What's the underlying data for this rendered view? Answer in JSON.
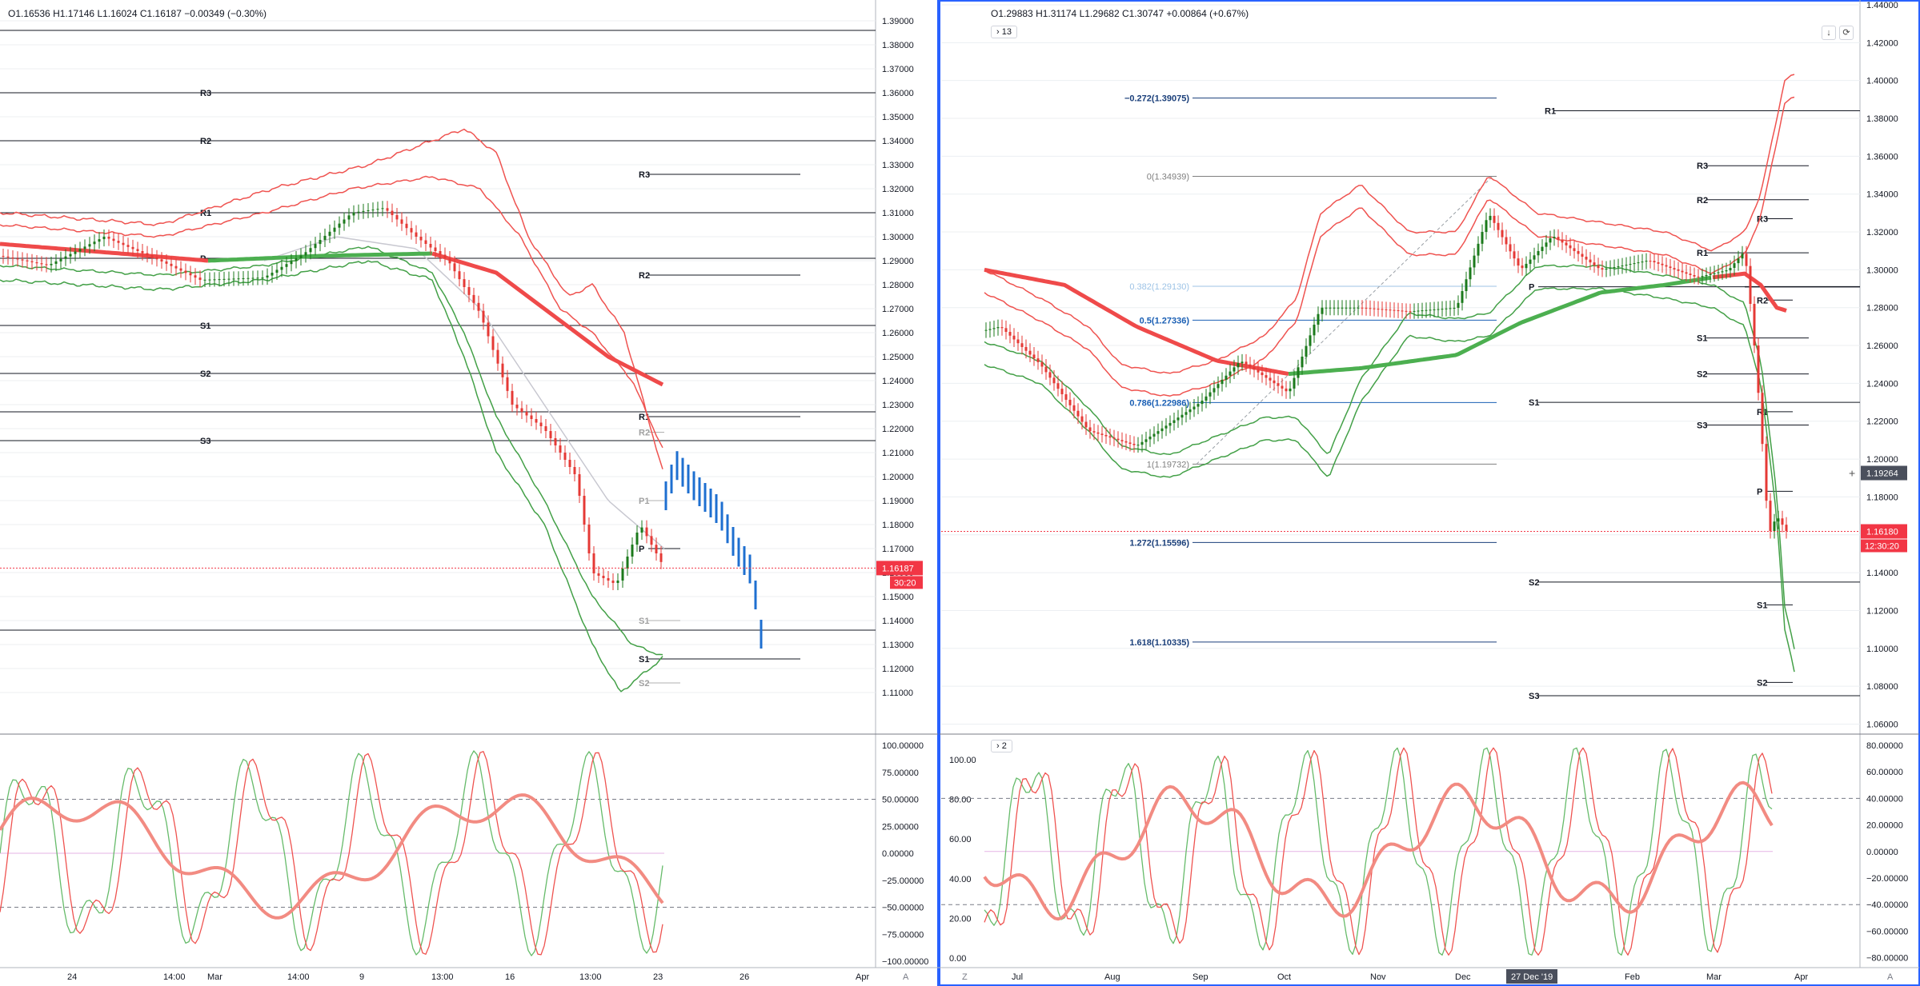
{
  "left": {
    "ohlc": {
      "o": "O1.16536",
      "h": "H1.17146",
      "l": "L1.16024",
      "c": "C1.16187",
      "chg": "−0.00349 (−0.30%)"
    },
    "price_badge": {
      "price": "1.16187",
      "timer": "30:20"
    },
    "yticks": [
      "1.39000",
      "1.38000",
      "1.37000",
      "1.36000",
      "1.35000",
      "1.34000",
      "1.33000",
      "1.32000",
      "1.31000",
      "1.30000",
      "1.29000",
      "1.28000",
      "1.27000",
      "1.26000",
      "1.25000",
      "1.24000",
      "1.23000",
      "1.22000",
      "1.21000",
      "1.20000",
      "1.19000",
      "1.18000",
      "1.17000",
      "1.16000",
      "1.15000",
      "1.14000",
      "1.13000",
      "1.12000",
      "1.11000"
    ],
    "osc_ticks": [
      "100.00000",
      "75.00000",
      "50.00000",
      "25.00000",
      "0.00000",
      "−25.00000",
      "−50.00000",
      "−75.00000",
      "−100.00000"
    ],
    "xticks": [
      "24",
      "14:00",
      "Mar",
      "14:00",
      "9",
      "13:00",
      "16",
      "13:00",
      "23",
      "26",
      "Apr"
    ],
    "pivots": [
      "R3",
      "R2",
      "R1",
      "P",
      "S1",
      "S2",
      "S3",
      "R3",
      "R2",
      "R1",
      "R2",
      "P1",
      "P",
      "S1",
      "S1",
      "S2"
    ],
    "corner": "A"
  },
  "right": {
    "ohlc": {
      "o": "O1.29883",
      "h": "H1.31174",
      "l": "L1.29682",
      "c": "C1.30747",
      "chg": "+0.00864 (+0.67%)"
    },
    "collapse_main": "13",
    "collapse_osc": "2",
    "crosshair_price": "1.19264",
    "price_badge": {
      "price": "1.16180",
      "timer": "12:30:20"
    },
    "xhair_date": "27 Dec '19",
    "yticks": [
      "1.44000",
      "1.42000",
      "1.40000",
      "1.38000",
      "1.36000",
      "1.34000",
      "1.32000",
      "1.30000",
      "1.28000",
      "1.26000",
      "1.24000",
      "1.22000",
      "1.20000",
      "1.18000",
      "1.16000",
      "1.14000",
      "1.12000",
      "1.10000",
      "1.08000",
      "1.06000"
    ],
    "osc_right_ticks": [
      "80.00000",
      "60.00000",
      "40.00000",
      "20.00000",
      "0.00000",
      "−20.00000",
      "−40.00000",
      "−60.00000",
      "−80.00000"
    ],
    "osc_left_ticks": [
      "100.00",
      "80.00",
      "60.00",
      "40.00",
      "20.00",
      "0.00"
    ],
    "xticks": [
      "Jul",
      "Aug",
      "Sep",
      "Oct",
      "Nov",
      "Dec",
      "Feb",
      "Mar",
      "Apr"
    ],
    "fib": [
      "−0.272(1.39075)",
      "0(1.34939)",
      "0.382(1.29130)",
      "0.5(1.27336)",
      "0.786(1.22986)",
      "1(1.19732)",
      "1.272(1.15596)",
      "1.618(1.10335)"
    ],
    "pivots": [
      "R1",
      "R3",
      "R2",
      "R3",
      "R1",
      "P",
      "R2",
      "S1",
      "S2",
      "S1",
      "R1",
      "S3",
      "P",
      "S2",
      "S1",
      "S2",
      "S3"
    ],
    "corner_left": "Z",
    "corner_right": "A"
  },
  "colors": {
    "up": "#26a69a",
    "down": "#ef5350",
    "bull_bar": "#1b7a1b",
    "bear_bar": "#e53935",
    "blue": "#1e6fd0",
    "badge": "#f23645"
  }
}
